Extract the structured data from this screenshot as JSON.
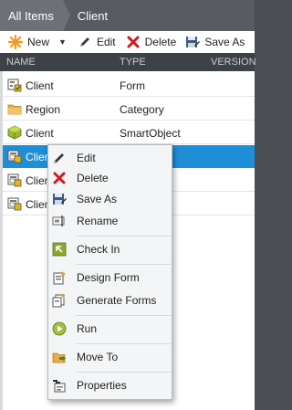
{
  "breadcrumb": {
    "root": "All Items",
    "current": "Client"
  },
  "toolbar": {
    "new_label": "New",
    "edit_label": "Edit",
    "delete_label": "Delete",
    "save_as_label": "Save As"
  },
  "columns": {
    "name": "NAME",
    "type": "TYPE",
    "version": "VERSION"
  },
  "rows": [
    {
      "name": "Client",
      "type": "Form",
      "icon": "form-icon"
    },
    {
      "name": "Region",
      "type": "Category",
      "icon": "folder-icon"
    },
    {
      "name": "Client",
      "type": "SmartObject",
      "icon": "smartobject-cube-icon"
    },
    {
      "name": "Client",
      "type": "",
      "icon": "view-icon"
    },
    {
      "name": "Client",
      "type": "",
      "icon": "view-icon"
    },
    {
      "name": "Client",
      "type": "",
      "icon": "view-icon"
    }
  ],
  "context_menu": {
    "edit": "Edit",
    "delete": "Delete",
    "save_as": "Save As",
    "rename": "Rename",
    "check_in": "Check In",
    "design_form": "Design Form",
    "generate_forms": "Generate Forms",
    "run": "Run",
    "move_to": "Move To",
    "properties": "Properties"
  },
  "colors": {
    "selection": "#1e8fd6",
    "header_bg": "#3e4247",
    "delete_red": "#d0191b",
    "new_orange": "#f29a1d"
  }
}
